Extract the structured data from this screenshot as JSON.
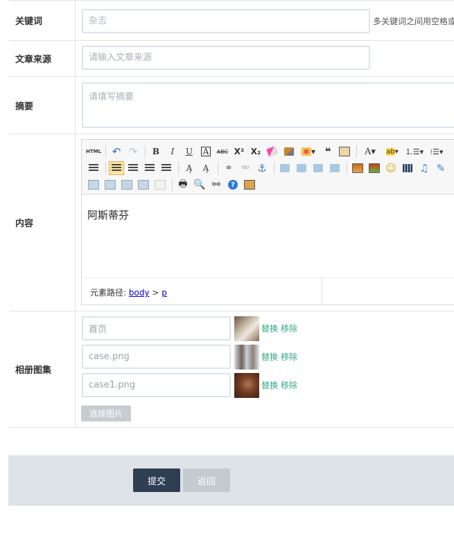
{
  "form": {
    "keywords": {
      "label": "关键词",
      "placeholder": "杂志",
      "hint": "多关键词之间用空格或"
    },
    "source": {
      "label": "文章来源",
      "placeholder": "请输入文章来源"
    },
    "summary": {
      "label": "摘要",
      "placeholder": "请填写摘要"
    },
    "content": {
      "label": "内容",
      "body_text": "阿斯蒂芬",
      "status_prefix": "元素路径:",
      "path_body": "body",
      "path_sep": ">",
      "path_p": "p",
      "toolbar_html_label": "HTML"
    },
    "gallery": {
      "label": "相册图集",
      "items": [
        {
          "value": "首页",
          "replace": "替换",
          "remove": "移除"
        },
        {
          "value": "case.png",
          "replace": "替换",
          "remove": "移除"
        },
        {
          "value": "case1.png",
          "replace": "替换",
          "remove": "移除"
        }
      ],
      "pick_label": "选择图片"
    }
  },
  "footer": {
    "submit_label": "提交",
    "back_label": "返回"
  }
}
